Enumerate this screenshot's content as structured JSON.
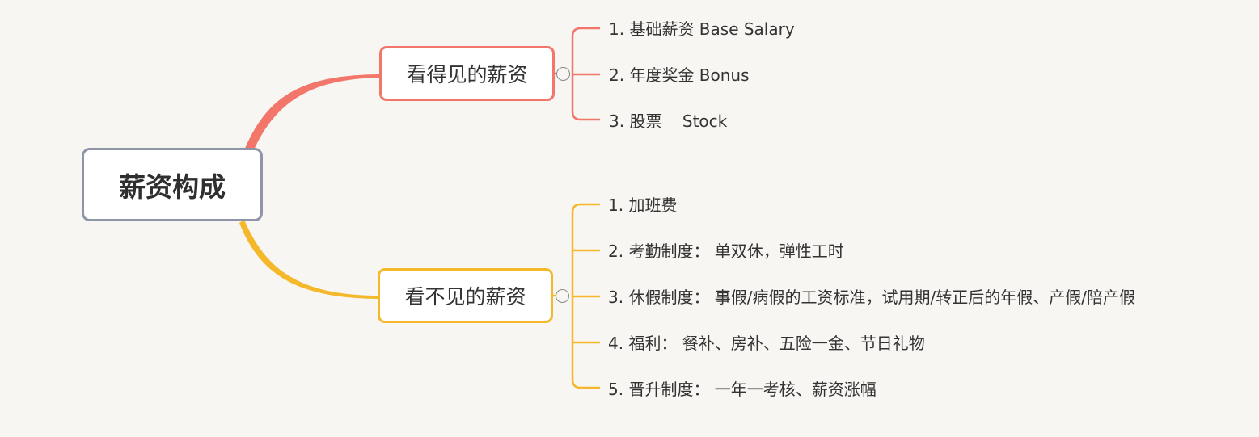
{
  "root": {
    "label": "薪资构成"
  },
  "branches": [
    {
      "label": "看得见的薪资",
      "color": "#f2766a",
      "items": [
        "1. 基础薪资 Base Salary",
        "2. 年度奖金 Bonus",
        "3. 股票    Stock"
      ]
    },
    {
      "label": "看不见的薪资",
      "color": "#f5b82a",
      "items": [
        "1. 加班费",
        "2. 考勤制度： 单双休，弹性工时",
        "3. 休假制度： 事假/病假的工资标准，试用期/转正后的年假、产假/陪产假",
        "4. 福利： 餐补、房补、五险一金、节日礼物",
        "5. 晋升制度： 一年一考核、薪资涨幅"
      ]
    }
  ],
  "colors": {
    "root_border": "#8e95a7",
    "background": "#f8f6f3",
    "collapse_icon": "#8a8a8a"
  }
}
